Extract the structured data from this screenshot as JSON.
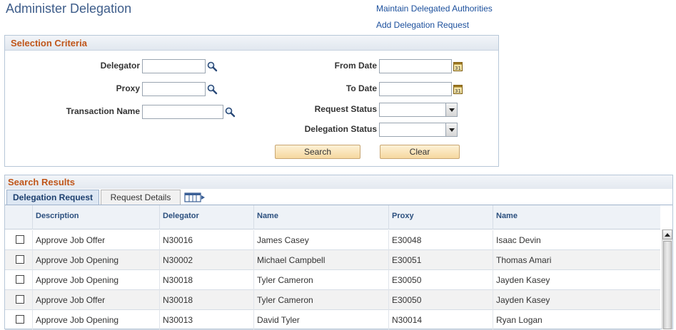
{
  "page": {
    "title": "Administer Delegation"
  },
  "links": {
    "maintain": "Maintain Delegated Authorities",
    "add": "Add Delegation Request"
  },
  "criteria": {
    "title": "Selection Criteria",
    "delegator_label": "Delegator",
    "delegator_value": "",
    "proxy_label": "Proxy",
    "proxy_value": "",
    "transaction_label": "Transaction Name",
    "transaction_value": "",
    "from_date_label": "From Date",
    "from_date_value": "",
    "to_date_label": "To Date",
    "to_date_value": "",
    "request_status_label": "Request Status",
    "request_status_value": "",
    "delegation_status_label": "Delegation Status",
    "delegation_status_value": "",
    "search_button": "Search",
    "clear_button": "Clear"
  },
  "results": {
    "title": "Search Results",
    "tabs": [
      {
        "label": "Delegation Request",
        "active": true
      },
      {
        "label": "Request Details",
        "active": false
      }
    ],
    "columns": [
      "Description",
      "Delegator",
      "Name",
      "Proxy",
      "Name"
    ],
    "rows": [
      {
        "description": "Approve Job Offer",
        "delegator": "N30016",
        "delegator_name": "James Casey",
        "proxy": "E30048",
        "proxy_name": "Isaac Devin"
      },
      {
        "description": "Approve Job Opening",
        "delegator": "N30002",
        "delegator_name": "Michael Campbell",
        "proxy": "E30051",
        "proxy_name": "Thomas Amari"
      },
      {
        "description": "Approve Job Opening",
        "delegator": "N30018",
        "delegator_name": "Tyler Cameron",
        "proxy": "E30050",
        "proxy_name": "Jayden Kasey"
      },
      {
        "description": "Approve Job Offer",
        "delegator": "N30018",
        "delegator_name": "Tyler Cameron",
        "proxy": "E30050",
        "proxy_name": "Jayden Kasey"
      },
      {
        "description": "Approve Job Opening",
        "delegator": "N30013",
        "delegator_name": "David Tyler",
        "proxy": "N30014",
        "proxy_name": "Ryan Logan"
      }
    ]
  },
  "colors": {
    "title_blue": "#3e5d8a",
    "link_blue": "#1b4f9c",
    "section_orange": "#c0561a",
    "button_fill": "#f6d89f"
  }
}
